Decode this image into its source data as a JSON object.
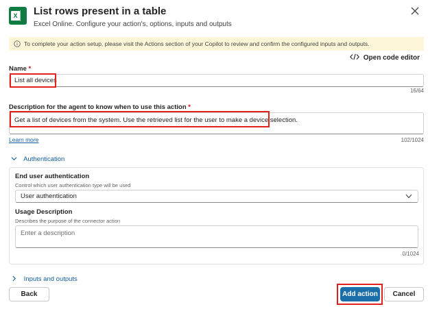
{
  "header": {
    "title": "List rows present in a table",
    "subtitle": "Excel Online. Configure your action's, options, inputs and outputs",
    "app_icon": "excel-icon",
    "app_icon_letter": "X",
    "close_icon": "close-icon"
  },
  "banner": {
    "icon": "info-icon",
    "text": "To complete your action setup, please visit the Actions section of your Copilot to review and confirm the configured inputs and outputs."
  },
  "code_editor": {
    "icon": "code-icon",
    "label": "Open code editor"
  },
  "name_field": {
    "label": "Name",
    "required_mark": "*",
    "value": "List all devices",
    "counter": "16/64"
  },
  "description_field": {
    "label": "Description for the agent to know when to use this action",
    "required_mark": "*",
    "value": "Get a list of devices from the system. Use the retrieved list for the user to make a device selection.",
    "counter": "102/1024",
    "learn_more": "Learn more"
  },
  "authentication": {
    "section_label": "Authentication",
    "expanded": true,
    "end_user_auth": {
      "label": "End user authentication",
      "help": "Control which user authentication type will be used",
      "selected": "User authentication"
    },
    "usage_description": {
      "label": "Usage Description",
      "help": "Describes the purpose of the connector action",
      "placeholder": "Enter a description",
      "counter": "0/1024"
    }
  },
  "inputs_outputs": {
    "section_label": "Inputs and outputs",
    "expanded": false
  },
  "footer": {
    "back_label": "Back",
    "add_label": "Add action",
    "cancel_label": "Cancel"
  },
  "colors": {
    "primary": "#1b6fa8",
    "highlight": "#e0201b",
    "banner_bg": "#fdf6d8",
    "link": "#115ea3",
    "excel_green": "#107c41"
  }
}
